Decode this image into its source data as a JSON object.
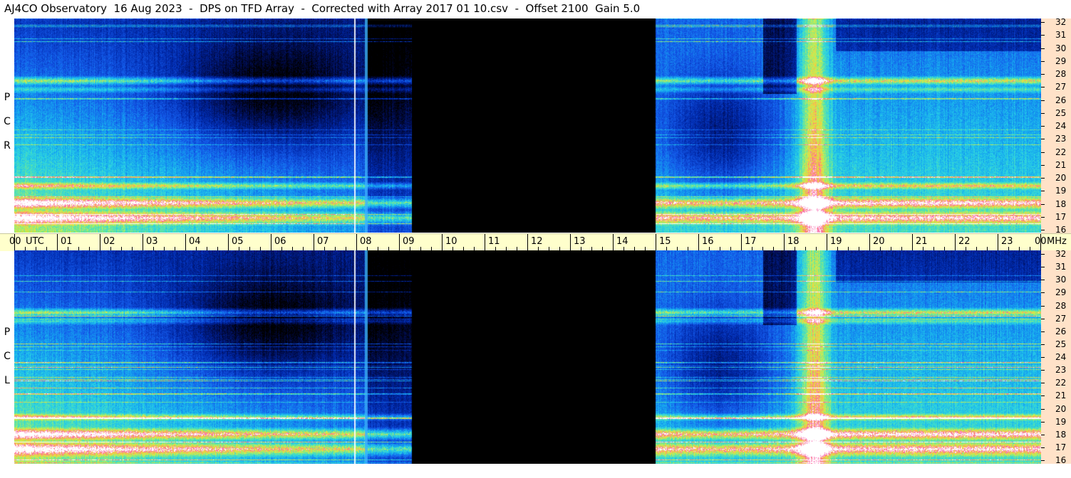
{
  "title": "AJ4CO Observatory  16 Aug 2023  -  DPS on TFD Array  -  Corrected with Array 2017 01 10.csv  -  Offset 2100  Gain 5.0",
  "panels": [
    {
      "id": "rcp",
      "label": [
        "R",
        "C",
        "P"
      ]
    },
    {
      "id": "lcp",
      "label": [
        "L",
        "C",
        "P"
      ]
    }
  ],
  "frequency_axis": {
    "unit": "MHz",
    "labels": [
      "32",
      "31",
      "30",
      "29",
      "28",
      "27",
      "26",
      "25",
      "24",
      "23",
      "22",
      "21",
      "20",
      "19",
      "18",
      "17",
      "16"
    ]
  },
  "time_axis": {
    "labels": [
      "00",
      "01",
      "02",
      "03",
      "04",
      "05",
      "06",
      "07",
      "08",
      "09",
      "10",
      "11",
      "12",
      "13",
      "14",
      "15",
      "16",
      "17",
      "18",
      "19",
      "20",
      "21",
      "22",
      "23",
      "00"
    ],
    "utc_label": "UTC",
    "unit_label": "MHz"
  },
  "data_gap_utc": [
    "09.3",
    "15.0"
  ]
}
